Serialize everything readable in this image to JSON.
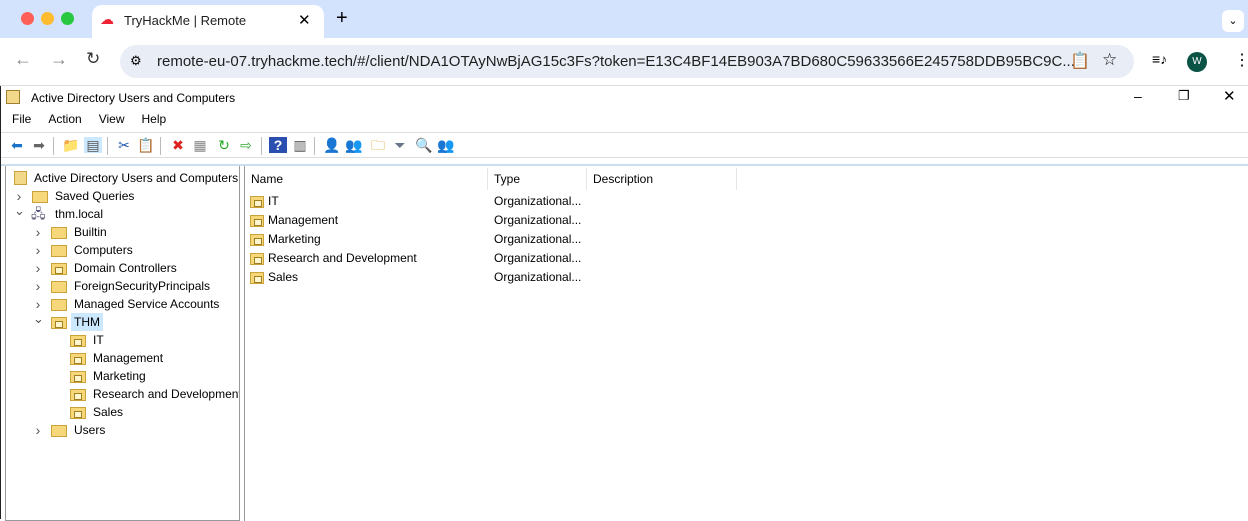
{
  "browser": {
    "tab_title": "TryHackMe | Remote",
    "url": "remote-eu-07.tryhackme.tech/#/client/NDA1OTAyNwBjAG15c3Fs?token=E13C4BF14EB903A7BD680C59633566E245758DDB95BC9C...",
    "profile_initial": "W",
    "colors": {
      "tabbar": "#d3e3fd",
      "profile": "#0b5345"
    }
  },
  "app": {
    "title": "Active Directory Users and Computers",
    "menu": [
      "File",
      "Action",
      "View",
      "Help"
    ],
    "toolbar": [
      "back-icon",
      "forward-icon",
      "up-folder-icon",
      "show-hide-console-tree-icon",
      "cut-icon",
      "paste-icon",
      "delete-icon",
      "properties-icon",
      "refresh-icon",
      "export-list-icon",
      "help-icon",
      "action-pane-icon",
      "new-user-icon",
      "new-group-icon",
      "new-ou-icon",
      "filter-icon",
      "find-icon",
      "delegate-control-icon"
    ]
  },
  "tree": {
    "root": "Active Directory Users and Computers [",
    "items": [
      {
        "label": "Saved Queries",
        "level": 1,
        "chev": ">",
        "icon": "folder"
      },
      {
        "label": "thm.local",
        "level": 1,
        "chev": "v",
        "icon": "domain"
      },
      {
        "label": "Builtin",
        "level": 2,
        "chev": ">",
        "icon": "folder"
      },
      {
        "label": "Computers",
        "level": 2,
        "chev": ">",
        "icon": "folder"
      },
      {
        "label": "Domain Controllers",
        "level": 2,
        "chev": ">",
        "icon": "ou"
      },
      {
        "label": "ForeignSecurityPrincipals",
        "level": 2,
        "chev": ">",
        "icon": "folder"
      },
      {
        "label": "Managed Service Accounts",
        "level": 2,
        "chev": ">",
        "icon": "folder"
      },
      {
        "label": "THM",
        "level": 2,
        "chev": "v",
        "icon": "ou",
        "selected": true
      },
      {
        "label": "IT",
        "level": 3,
        "chev": "",
        "icon": "ou"
      },
      {
        "label": "Management",
        "level": 3,
        "chev": "",
        "icon": "ou"
      },
      {
        "label": "Marketing",
        "level": 3,
        "chev": "",
        "icon": "ou"
      },
      {
        "label": "Research and Development",
        "level": 3,
        "chev": "",
        "icon": "ou"
      },
      {
        "label": "Sales",
        "level": 3,
        "chev": "",
        "icon": "ou"
      },
      {
        "label": "Users",
        "level": 2,
        "chev": ">",
        "icon": "folder"
      }
    ]
  },
  "list": {
    "columns": [
      "Name",
      "Type",
      "Description"
    ],
    "rows": [
      {
        "name": "IT",
        "type": "Organizational...",
        "description": ""
      },
      {
        "name": "Management",
        "type": "Organizational...",
        "description": ""
      },
      {
        "name": "Marketing",
        "type": "Organizational...",
        "description": ""
      },
      {
        "name": "Research and Development",
        "type": "Organizational...",
        "description": ""
      },
      {
        "name": "Sales",
        "type": "Organizational...",
        "description": ""
      }
    ]
  }
}
